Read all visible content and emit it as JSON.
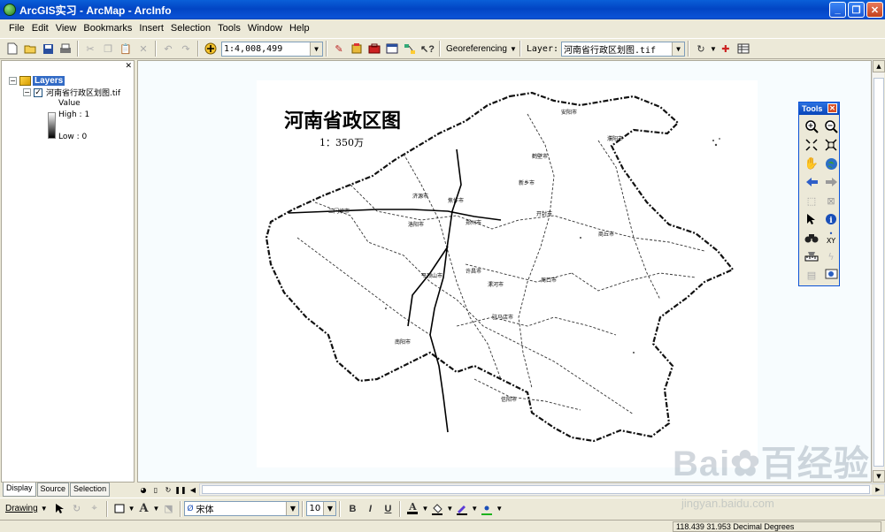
{
  "window": {
    "title": "ArcGIS实习 - ArcMap - ArcInfo"
  },
  "menu": [
    "File",
    "Edit",
    "View",
    "Bookmarks",
    "Insert",
    "Selection",
    "Tools",
    "Window",
    "Help"
  ],
  "toolbar": {
    "scale_value": "1:4,008,499",
    "georef_label": "Georeferencing",
    "layer_label": "Layer:",
    "layer_value": "河南省行政区划图.tif"
  },
  "toc": {
    "root_label": "Layers",
    "layer_name": "河南省行政区划图.tif",
    "value_label": "Value",
    "high_label": "High : 1",
    "low_label": "Low : 0",
    "tabs": [
      "Display",
      "Source",
      "Selection"
    ]
  },
  "map": {
    "title": "河南省政区图",
    "scale": "1：350万"
  },
  "tools_window": {
    "title": "Tools"
  },
  "drawing": {
    "drawing_label": "Drawing",
    "font_name": "宋体",
    "font_size": "10",
    "bold": "B",
    "italic": "I",
    "underline": "U",
    "font_color_glyph": "A"
  },
  "status": {
    "coords": "118.439  31.953 Decimal Degrees"
  },
  "watermark": {
    "logo": "Bai✿百经验",
    "url": "jingyan.baidu.com"
  },
  "colors": {
    "title_blue": "#0a5fd8",
    "selection_blue": "#316ac5",
    "map_bg": "#f7fcfe"
  }
}
